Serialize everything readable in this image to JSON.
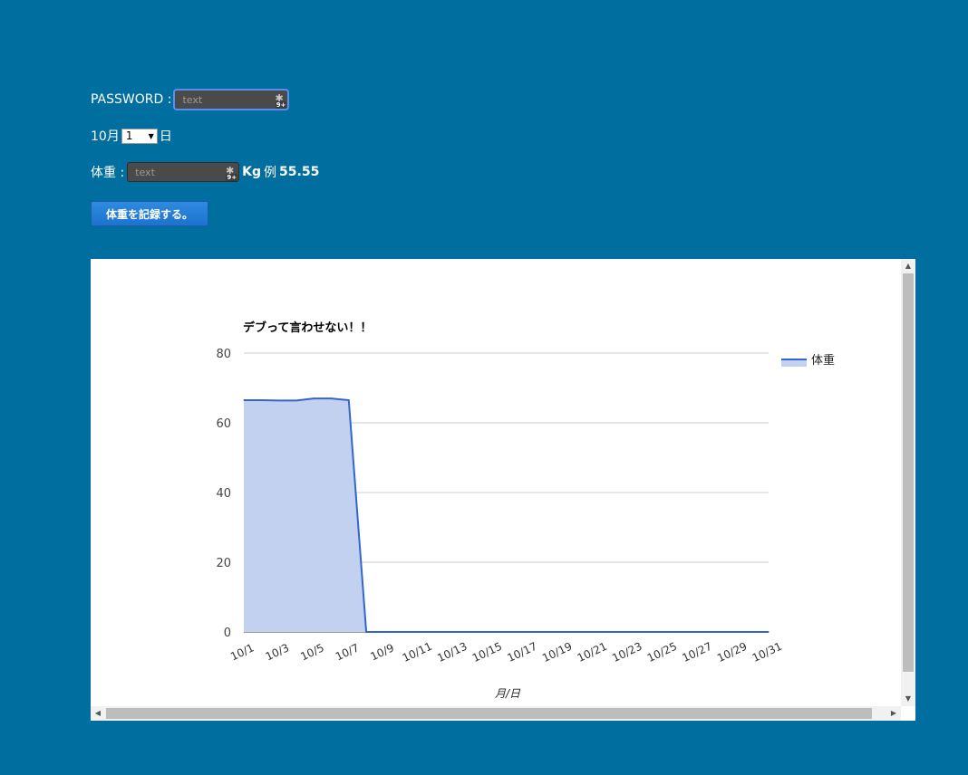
{
  "form": {
    "password_label": "PASSWORD :",
    "password_placeholder": "text",
    "month_label": "10月",
    "day_selected": "1",
    "day_suffix": "日",
    "weight_label": "体重 :",
    "weight_placeholder": "text",
    "weight_unit": "Kg",
    "example_prefix": "例",
    "example_value": "55.55",
    "badge_count": "9+",
    "record_button": "体重を記録する。"
  },
  "colors": {
    "background": "#006e9e",
    "line": "#3366cc",
    "area": "#c2d1ef",
    "button": "#2680d8"
  },
  "chart_data": {
    "type": "area",
    "title": "デブって言わせない！！",
    "xlabel": "月/日",
    "ylabel": "",
    "ylim": [
      0,
      80
    ],
    "yticks": [
      0,
      20,
      40,
      60,
      80
    ],
    "grid": true,
    "legend_position": "right",
    "categories": [
      "10/1",
      "10/2",
      "10/3",
      "10/4",
      "10/5",
      "10/6",
      "10/7",
      "10/8",
      "10/9",
      "10/10",
      "10/11",
      "10/12",
      "10/13",
      "10/14",
      "10/15",
      "10/16",
      "10/17",
      "10/18",
      "10/19",
      "10/20",
      "10/21",
      "10/22",
      "10/23",
      "10/24",
      "10/25",
      "10/26",
      "10/27",
      "10/28",
      "10/29",
      "10/30",
      "10/31"
    ],
    "tick_labels": [
      "10/1",
      "10/3",
      "10/5",
      "10/7",
      "10/9",
      "10/11",
      "10/13",
      "10/15",
      "10/17",
      "10/19",
      "10/21",
      "10/23",
      "10/25",
      "10/27",
      "10/29",
      "10/31"
    ],
    "series": [
      {
        "name": "体重",
        "values": [
          66.5,
          66.5,
          66.4,
          66.4,
          67.0,
          67.0,
          66.5,
          0,
          0,
          0,
          0,
          0,
          0,
          0,
          0,
          0,
          0,
          0,
          0,
          0,
          0,
          0,
          0,
          0,
          0,
          0,
          0,
          0,
          0,
          0,
          0
        ]
      }
    ]
  }
}
